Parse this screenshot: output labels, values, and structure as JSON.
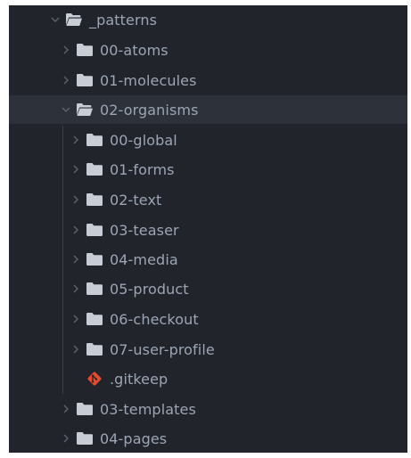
{
  "tree": {
    "root": {
      "label": "_patterns",
      "icon": "folder-open-icon",
      "expanded": true
    },
    "level1_before": [
      {
        "label": "00-atoms",
        "icon": "folder-icon",
        "expanded": false
      },
      {
        "label": "01-molecules",
        "icon": "folder-icon",
        "expanded": false
      }
    ],
    "organisms": {
      "label": "02-organisms",
      "icon": "folder-open-icon",
      "expanded": true,
      "selected": true
    },
    "organism_children": [
      {
        "label": "00-global",
        "icon": "folder-icon",
        "expanded": false
      },
      {
        "label": "01-forms",
        "icon": "folder-icon",
        "expanded": false
      },
      {
        "label": "02-text",
        "icon": "folder-icon",
        "expanded": false
      },
      {
        "label": "03-teaser",
        "icon": "folder-icon",
        "expanded": false
      },
      {
        "label": "04-media",
        "icon": "folder-icon",
        "expanded": false
      },
      {
        "label": "05-product",
        "icon": "folder-icon",
        "expanded": false
      },
      {
        "label": "06-checkout",
        "icon": "folder-icon",
        "expanded": false
      },
      {
        "label": "07-user-profile",
        "icon": "folder-icon",
        "expanded": false
      }
    ],
    "gitkeep": {
      "label": ".gitkeep",
      "icon": "git-icon"
    },
    "level1_after": [
      {
        "label": "03-templates",
        "icon": "folder-icon",
        "expanded": false
      },
      {
        "label": "04-pages",
        "icon": "folder-icon",
        "expanded": false
      }
    ]
  },
  "colors": {
    "background": "#21252b",
    "selected_row": "#2c313a",
    "text": "#9da5b4",
    "icon": "#c8ccd4",
    "chevron": "#5c6370",
    "git": "#e8482e"
  }
}
